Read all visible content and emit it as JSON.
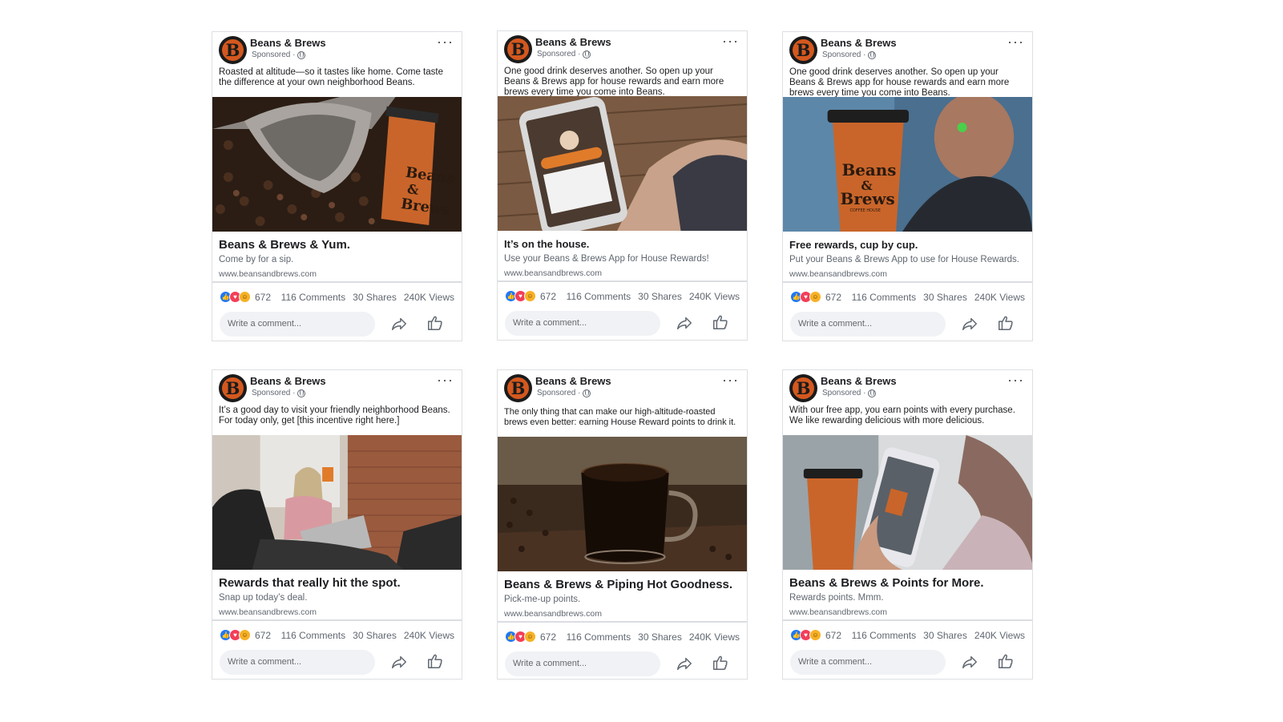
{
  "brand": {
    "page_name": "Beans & Brews",
    "sponsored": "Sponsored ·",
    "avatar_letter": "B",
    "accent": "#d4581f"
  },
  "cards": [
    {
      "post_text": "Roasted at altitude—so it tastes like home. Come taste the difference at your own neighborhood Beans.",
      "headline": "Beans & Brews & Yum.",
      "description": "Come by for a sip.",
      "url": "www.beansandbrews.com",
      "reactions": "672",
      "comments": "116 Comments",
      "shares": "30 Shares",
      "views": "240K Views",
      "comment_placeholder": "Write a comment..."
    },
    {
      "post_text": "One good drink deserves another. So open up your Beans & Brews app for house rewards and earn more brews every time you come into Beans.",
      "headline": "It’s on the house.",
      "description": "Use your Beans & Brews App for House Rewards!",
      "url": "www.beansandbrews.com",
      "reactions": "672",
      "comments": "116 Comments",
      "shares": "30 Shares",
      "views": "240K Views",
      "comment_placeholder": "Write a comment..."
    },
    {
      "post_text": "One good drink deserves another. So open up your Beans & Brews app for house rewards and earn more brews every time you come into Beans.",
      "headline": "Free rewards, cup by cup.",
      "description": "Put your Beans & Brews App to use for House Rewards.",
      "url": "www.beansandbrews.com",
      "reactions": "672",
      "comments": "116 Comments",
      "shares": "30 Shares",
      "views": "240K Views",
      "comment_placeholder": "Write a comment..."
    },
    {
      "post_text": "It’s a good day to visit your friendly neighborhood Beans. For today only, get [this incentive right here.]",
      "headline": "Rewards that really hit the spot.",
      "description": "Snap up today’s deal.",
      "url": "www.beansandbrews.com",
      "reactions": "672",
      "comments": "116 Comments",
      "shares": "30 Shares",
      "views": "240K Views",
      "comment_placeholder": "Write a comment..."
    },
    {
      "post_text": "The only thing that can make our high-altitude-roasted brews even better: earning House Reward points to drink it.",
      "headline": "Beans & Brews & Piping Hot Goodness.",
      "description": "Pick-me-up points.",
      "url": "www.beansandbrews.com",
      "reactions": "672",
      "comments": "116 Comments",
      "shares": "30 Shares",
      "views": "240K Views",
      "comment_placeholder": "Write a comment..."
    },
    {
      "post_text": "With our free app, you earn points with every purchase. We like rewarding delicious with more delicious.",
      "headline": "Beans & Brews & Points for More.",
      "description": "Rewards points. Mmm.",
      "url": "www.beansandbrews.com",
      "reactions": "672",
      "comments": "116 Comments",
      "shares": "30 Shares",
      "views": "240K Views",
      "comment_placeholder": "Write a comment..."
    }
  ],
  "cup_text": {
    "line1": "Beans",
    "line2": "&",
    "line3": "Brews",
    "line4": "COFFEE HOUSE"
  },
  "icons": {
    "more": "more-options-icon",
    "share": "share-icon",
    "like": "like-icon",
    "globe": "globe-icon"
  }
}
